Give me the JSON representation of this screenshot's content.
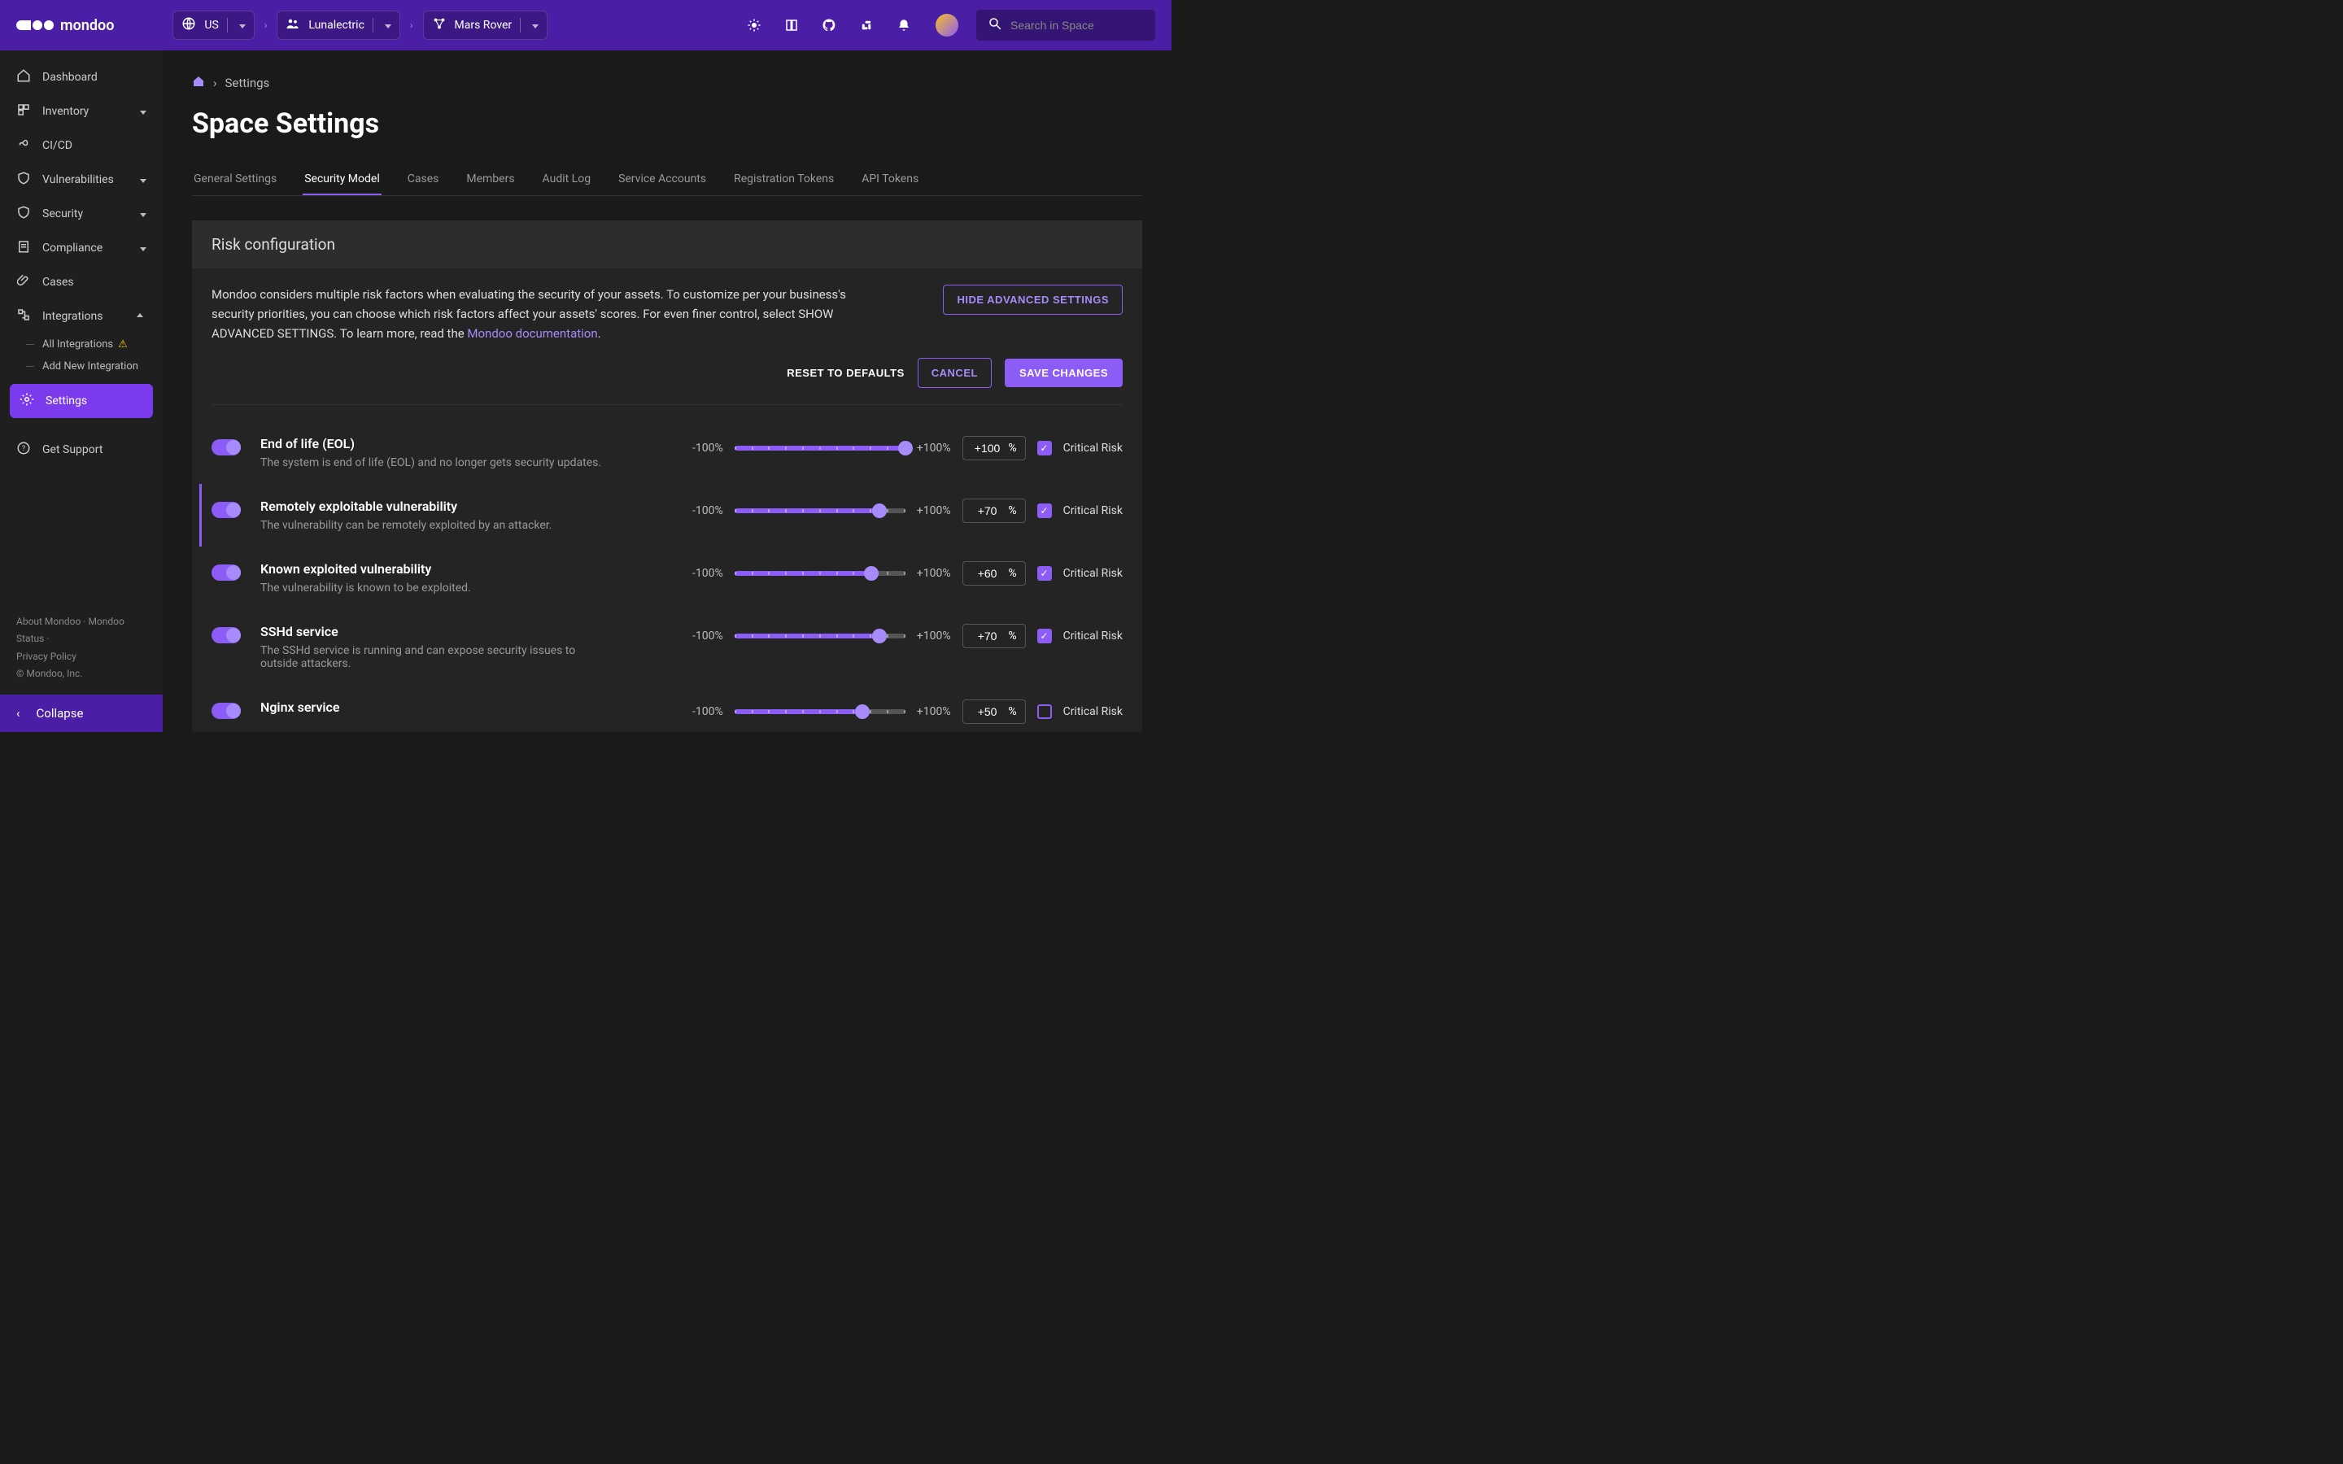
{
  "brand": "mondoo",
  "topnav": {
    "region": "US",
    "org": "Lunalectric",
    "space": "Mars Rover"
  },
  "search": {
    "placeholder": "Search in Space"
  },
  "sidebar": {
    "items": [
      {
        "label": "Dashboard"
      },
      {
        "label": "Inventory"
      },
      {
        "label": "CI/CD"
      },
      {
        "label": "Vulnerabilities"
      },
      {
        "label": "Security"
      },
      {
        "label": "Compliance"
      },
      {
        "label": "Cases"
      },
      {
        "label": "Integrations"
      }
    ],
    "integrations_sub": [
      {
        "label": "All Integrations"
      },
      {
        "label": "Add New Integration"
      }
    ],
    "settings": "Settings",
    "support": "Get Support",
    "footer": {
      "about": "About Mondoo",
      "status": "Mondoo Status",
      "privacy": "Privacy Policy",
      "copyright": "© Mondoo, Inc."
    },
    "collapse": "Collapse"
  },
  "breadcrumb": {
    "current": "Settings"
  },
  "page": {
    "title": "Space Settings"
  },
  "tabs": [
    "General Settings",
    "Security Model",
    "Cases",
    "Members",
    "Audit Log",
    "Service Accounts",
    "Registration Tokens",
    "API Tokens"
  ],
  "active_tab": "Security Model",
  "card": {
    "title": "Risk configuration",
    "desc_prefix": "Mondoo considers multiple risk factors when evaluating the security of your assets. To customize per your business's security priorities, you can choose which risk factors affect your assets' scores. For even finer control, select SHOW ADVANCED SETTINGS. To learn more, read the ",
    "desc_link": "Mondoo documentation",
    "desc_suffix": ".",
    "hide_btn": "HIDE ADVANCED SETTINGS",
    "reset_btn": "RESET TO DEFAULTS",
    "cancel_btn": "CANCEL",
    "save_btn": "SAVE CHANGES"
  },
  "slider": {
    "min_label": "-100%",
    "max_label": "+100%",
    "pct": "%",
    "critical": "Critical Risk"
  },
  "risks": [
    {
      "title": "End of life (EOL)",
      "desc": "The system is end of life (EOL) and no longer gets security updates.",
      "value": "+100",
      "pos": 100,
      "checked": true,
      "accent": false
    },
    {
      "title": "Remotely exploitable vulnerability",
      "desc": "The vulnerability can be remotely exploited by an attacker.",
      "value": "+70",
      "pos": 85,
      "checked": true,
      "accent": true
    },
    {
      "title": "Known exploited vulnerability",
      "desc": "The vulnerability is known to be exploited.",
      "value": "+60",
      "pos": 80,
      "checked": true,
      "accent": false
    },
    {
      "title": "SSHd service",
      "desc": "The SSHd service is running and can expose security issues to outside attackers.",
      "value": "+70",
      "pos": 85,
      "checked": true,
      "accent": false
    },
    {
      "title": "Nginx service",
      "desc": "",
      "value": "+50",
      "pos": 75,
      "checked": false,
      "accent": false
    }
  ]
}
